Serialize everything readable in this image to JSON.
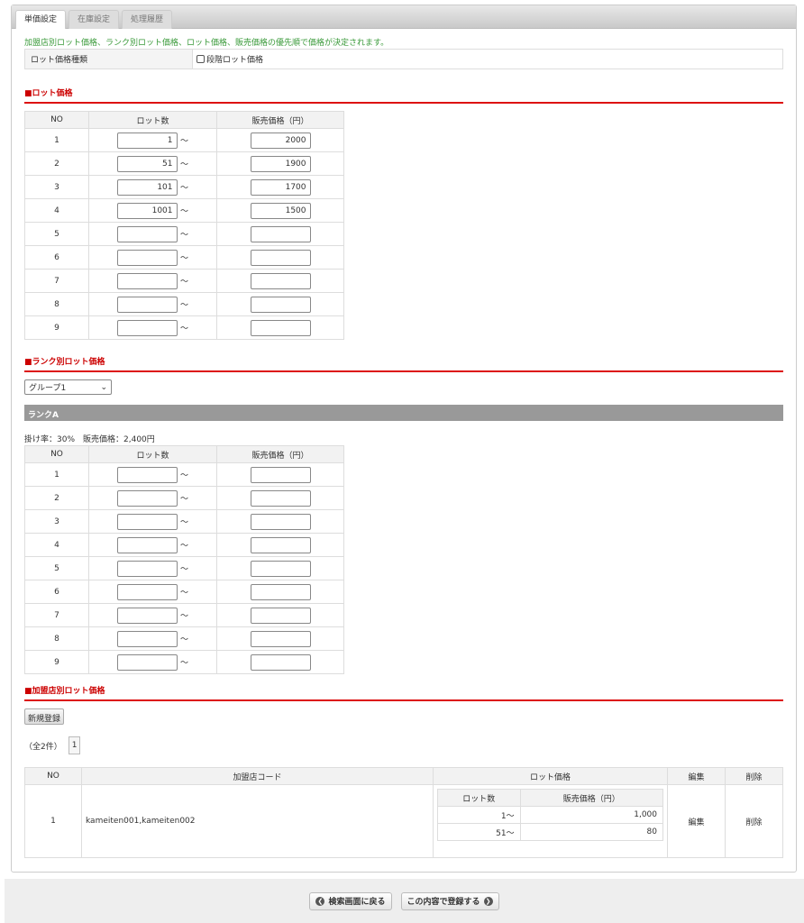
{
  "tabs": [
    "単価設定",
    "在庫設定",
    "処理履歴"
  ],
  "note": "加盟店別ロット価格、ランク別ロット価格、ロット価格、販売価格の優先順で価格が決定されます。",
  "kind": {
    "label": "ロット価格種類",
    "checkbox_label": "段階ロット価格",
    "checked": false
  },
  "lot": {
    "heading": "■ロット価格",
    "headers": [
      "NO",
      "ロット数",
      "販売価格（円）"
    ],
    "tilde": "～",
    "rows": [
      {
        "no": "1",
        "lot": "1",
        "price": "2000"
      },
      {
        "no": "2",
        "lot": "51",
        "price": "1900"
      },
      {
        "no": "3",
        "lot": "101",
        "price": "1700"
      },
      {
        "no": "4",
        "lot": "1001",
        "price": "1500"
      },
      {
        "no": "5",
        "lot": "",
        "price": ""
      },
      {
        "no": "6",
        "lot": "",
        "price": ""
      },
      {
        "no": "7",
        "lot": "",
        "price": ""
      },
      {
        "no": "8",
        "lot": "",
        "price": ""
      },
      {
        "no": "9",
        "lot": "",
        "price": ""
      }
    ]
  },
  "rank": {
    "heading": "■ランク別ロット価格",
    "group": "グループ1",
    "rank_title": "ランクA",
    "info": "掛け率：30%　販売価格：2,400円",
    "headers": [
      "NO",
      "ロット数",
      "販売価格（円）"
    ],
    "rows": [
      {
        "no": "1",
        "lot": "",
        "price": ""
      },
      {
        "no": "2",
        "lot": "",
        "price": ""
      },
      {
        "no": "3",
        "lot": "",
        "price": ""
      },
      {
        "no": "4",
        "lot": "",
        "price": ""
      },
      {
        "no": "5",
        "lot": "",
        "price": ""
      },
      {
        "no": "6",
        "lot": "",
        "price": ""
      },
      {
        "no": "7",
        "lot": "",
        "price": ""
      },
      {
        "no": "8",
        "lot": "",
        "price": ""
      },
      {
        "no": "9",
        "lot": "",
        "price": ""
      }
    ]
  },
  "store": {
    "heading": "■加盟店別ロット価格",
    "new_button": "新規登録",
    "count": "（全2件）",
    "page": "1",
    "headers": [
      "NO",
      "加盟店コード",
      "ロット価格",
      "編集",
      "削除"
    ],
    "inner_headers": [
      "ロット数",
      "販売価格（円）"
    ],
    "rows": [
      {
        "no": "1",
        "code": "kameiten001,kameiten002",
        "lots": [
          {
            "lot": "1～",
            "price": "1,000"
          },
          {
            "lot": "51～",
            "price": "80"
          }
        ],
        "edit": "編集",
        "delete": "削除"
      }
    ]
  },
  "footer": {
    "back": "検索画面に戻る",
    "register": "この内容で登録する"
  }
}
